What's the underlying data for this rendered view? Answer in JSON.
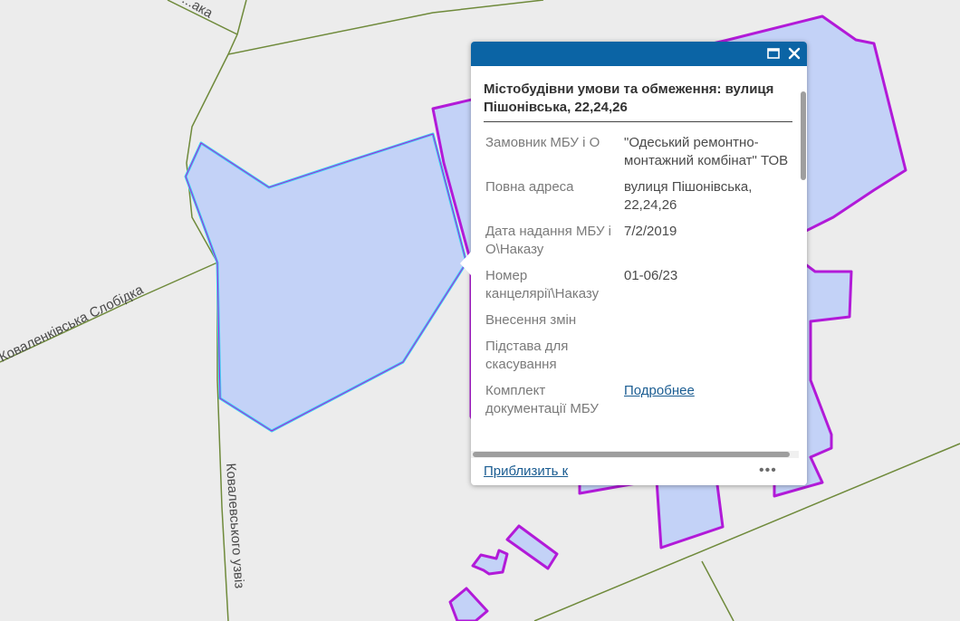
{
  "map": {
    "road_labels": [
      "Коваленківська Слобідка",
      "Ковалевського узвіз",
      "...ака"
    ],
    "colors": {
      "parcel_fill": "#c3d2f7",
      "parcel_outline": "#b21ad8",
      "selected_outline": "#3bd6f5",
      "road": "#6f8a3b",
      "background": "#ececec"
    }
  },
  "popup": {
    "header_color": "#0b64a5",
    "icons": {
      "maximize": "maximize-icon",
      "close": "close-icon"
    },
    "title": "Містобудівни умови та обмеження: вулиця Пішонівська, 22,24,26",
    "rows": [
      {
        "key": "Замовник МБУ і О",
        "value": "\"Одеський ремонтно-монтажний комбінат\" ТОВ"
      },
      {
        "key": "Повна адреса",
        "value": "вулиця Пішонівська, 22,24,26"
      },
      {
        "key": "Дата надання МБУ і О\\Наказу",
        "value": "7/2/2019"
      },
      {
        "key": "Номер канцелярії\\Наказу",
        "value": "01-06/23"
      },
      {
        "key": "Внесення змін",
        "value": ""
      },
      {
        "key": "Підстава для скасування",
        "value": ""
      },
      {
        "key": "Комплект документації МБУ",
        "link": "Подробнее"
      }
    ],
    "footer": {
      "zoom_label": "Приблизить к",
      "more_label": "•••"
    }
  }
}
